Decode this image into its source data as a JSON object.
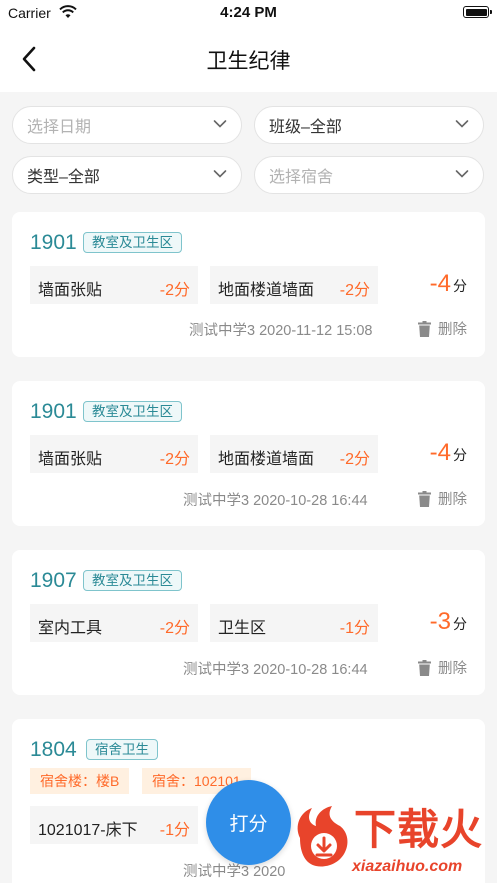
{
  "status_bar": {
    "carrier": "Carrier",
    "time": "4:24 PM"
  },
  "nav": {
    "title": "卫生纪律"
  },
  "filters": {
    "date_placeholder": "选择日期",
    "class_value": "班级–全部",
    "type_value": "类型–全部",
    "dorm_placeholder": "选择宿舍"
  },
  "records": [
    {
      "class": "1901",
      "tag": "教室及卫生区",
      "items": [
        {
          "name": "墙面张贴",
          "points": "-2分"
        },
        {
          "name": "地面楼道墙面",
          "points": "-2分"
        }
      ],
      "total": "-4",
      "total_unit": "分",
      "meta": "测试中学3  2020-11-12 15:08",
      "delete_label": "删除"
    },
    {
      "class": "1901",
      "tag": "教室及卫生区",
      "items": [
        {
          "name": "墙面张贴",
          "points": "-2分"
        },
        {
          "name": "地面楼道墙面",
          "points": "-2分"
        }
      ],
      "total": "-4",
      "total_unit": "分",
      "meta": "测试中学3  2020-10-28 16:44",
      "delete_label": "删除"
    },
    {
      "class": "1907",
      "tag": "教室及卫生区",
      "items": [
        {
          "name": "室内工具",
          "points": "-2分"
        },
        {
          "name": "卫生区",
          "points": "-1分"
        }
      ],
      "total": "-3",
      "total_unit": "分",
      "meta": "测试中学3  2020-10-28 16:44",
      "delete_label": "删除"
    },
    {
      "class": "1804",
      "tag": "宿舍卫生",
      "sub_tags": [
        "宿舍楼：楼B",
        "宿舍：102101"
      ],
      "items": [
        {
          "name": "1021017-床下",
          "points": "-1分"
        }
      ],
      "meta": "测试中学3  2020"
    }
  ],
  "fab": {
    "label": "打分"
  },
  "watermark": {
    "main": "下载火",
    "sub": "xiazaihuo.com"
  },
  "colors": {
    "accent_teal": "#2b8a96",
    "deduction_orange": "#ff6a2a",
    "fab_blue": "#2f8ee8",
    "background": "#f5f5f5"
  }
}
